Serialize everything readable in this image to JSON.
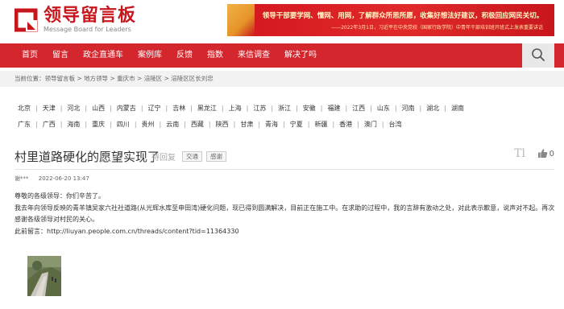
{
  "header": {
    "logo_cn": "领导留言板",
    "logo_en": "Message Board for Leaders",
    "brand_color": "#c8161d",
    "banner_line1": "领导干部要学网、懂网、用网，了解群众所思所愿，收集好想法好建议，积极回应网民关切。",
    "banner_line2": "——2022年3月1日，习近平在中央党校（国家行政学院）中青年干部培训班开班式上发表重要讲话"
  },
  "nav": {
    "items": [
      "首页",
      "留言",
      "政企直通车",
      "案例库",
      "反馈",
      "指数",
      "来信调查",
      "解决了吗"
    ],
    "search_icon": "search-icon"
  },
  "breadcrumb": {
    "prefix": "当前位置：",
    "items": [
      "领导留言板",
      "地方领导",
      "重庆市",
      "涪陵区",
      "涪陵区区长刘忠"
    ],
    "separator": " > "
  },
  "regions": {
    "row1": [
      "北京",
      "天津",
      "河北",
      "山西",
      "内蒙古",
      "辽宁",
      "吉林",
      "黑龙江",
      "上海",
      "江苏",
      "浙江",
      "安徽",
      "福建",
      "江西",
      "山东",
      "河南",
      "湖北",
      "湖南"
    ],
    "row2": [
      "广东",
      "广西",
      "海南",
      "重庆",
      "四川",
      "贵州",
      "云南",
      "西藏",
      "陕西",
      "甘肃",
      "青海",
      "宁夏",
      "新疆",
      "香港",
      "澳门",
      "台湾"
    ]
  },
  "message": {
    "title": "村里道路硬化的愿望实现了",
    "status": "待回复",
    "tags": [
      "交通",
      "感谢"
    ],
    "font_tool": "Tl",
    "thumbs_count": "0",
    "author": "谢***",
    "date": "2022-06-20 13:47",
    "content": [
      "尊敬的各级领导：你们辛苦了。",
      "我去年向领导反映的青羊镇吴家六社社道路(从光辉水库至申田湾)硬化问题，现已得到圆满解决，目前正在施工中。在求助的过程中，我的言辞有激动之处，对此表示歉意，说声对不起。再次感谢各级领导对村民的关心。",
      "此前留言：http://liuyan.people.com.cn/threads/content?tid=11364330"
    ]
  }
}
